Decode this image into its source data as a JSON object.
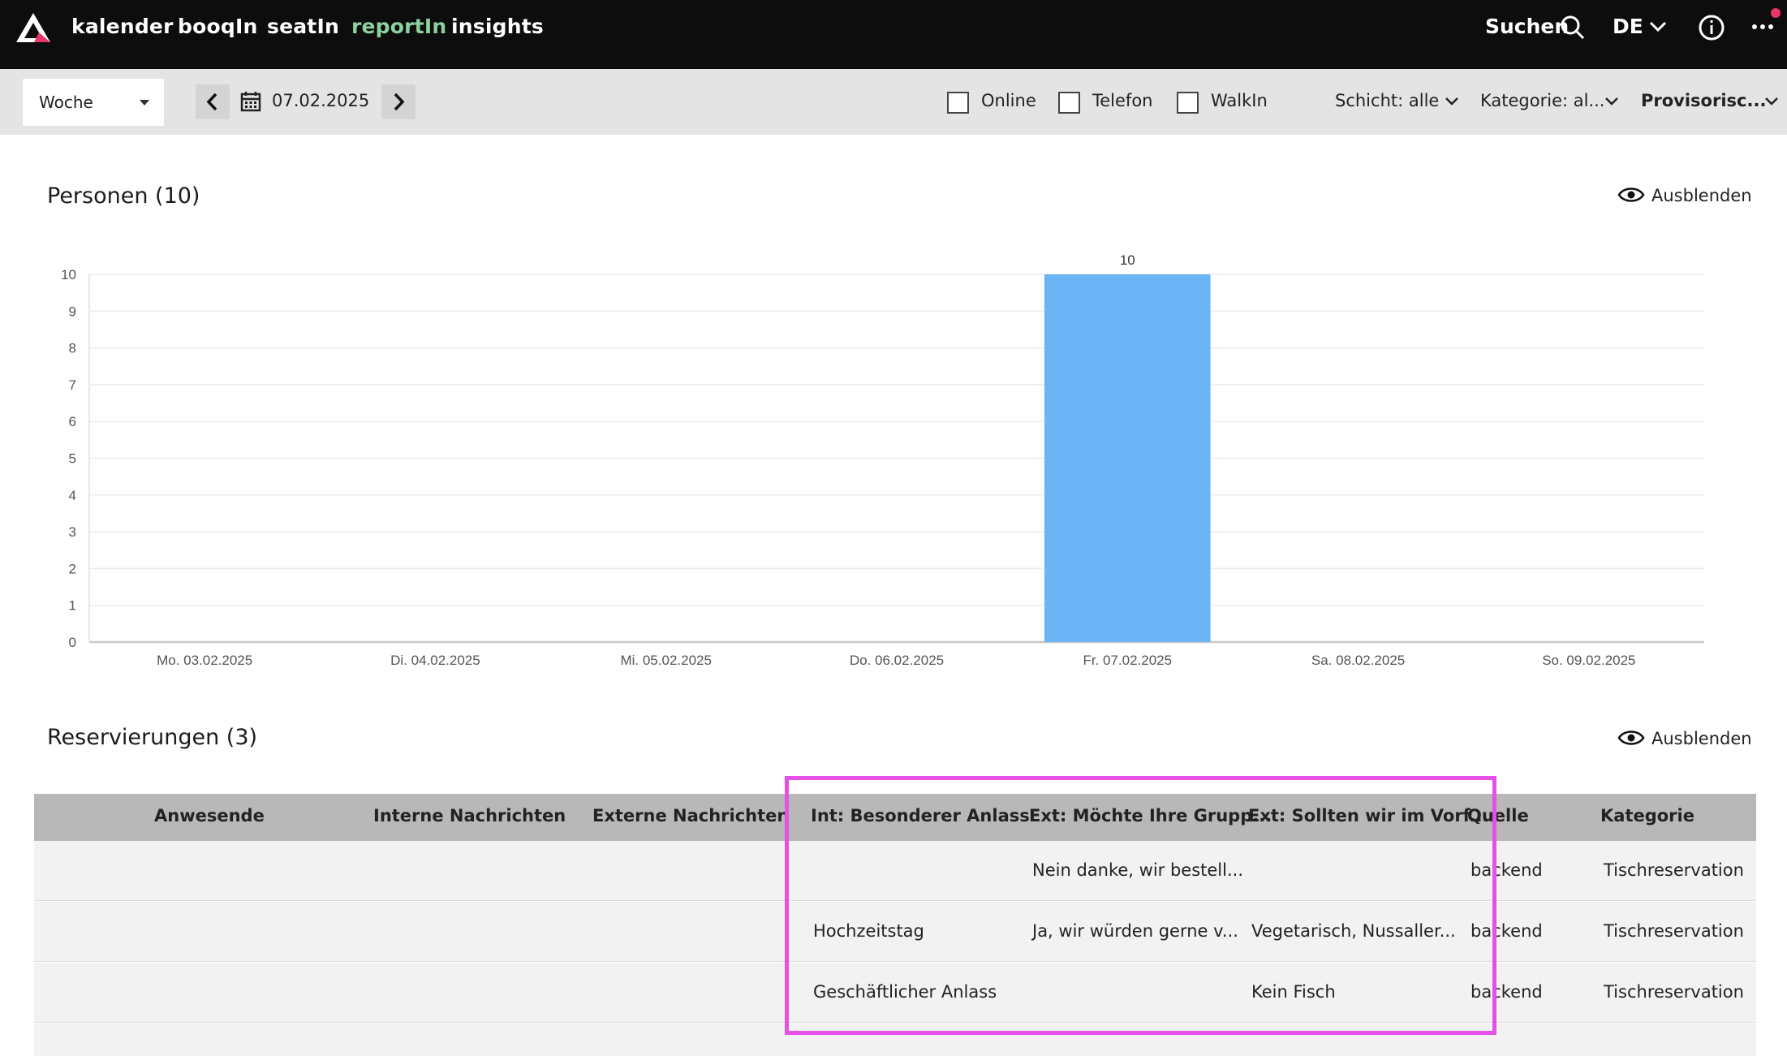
{
  "nav": {
    "items": [
      "kalender",
      "booqIn",
      "seatIn",
      "reportIn",
      "insights"
    ],
    "active": "reportIn",
    "search_label": "Suchen",
    "language": "DE"
  },
  "toolbar": {
    "period": "Woche",
    "date": "07.02.2025",
    "checkboxes": [
      "Online",
      "Telefon",
      "WalkIn"
    ],
    "filters": {
      "shift": "Schicht: alle",
      "category": "Kategorie: al...",
      "status": "Provisorisc..."
    }
  },
  "persons_section": {
    "title": "Personen (10)",
    "hide_label": "Ausblenden"
  },
  "chart_data": {
    "type": "bar",
    "categories": [
      "Mo. 03.02.2025",
      "Di. 04.02.2025",
      "Mi. 05.02.2025",
      "Do. 06.02.2025",
      "Fr. 07.02.2025",
      "Sa. 08.02.2025",
      "So. 09.02.2025"
    ],
    "values": [
      0,
      0,
      0,
      0,
      10,
      0,
      0
    ],
    "data_labels": [
      "",
      "",
      "",
      "",
      "10",
      "",
      ""
    ],
    "ylim": [
      0,
      10
    ],
    "yticks": [
      "0",
      "1",
      "2",
      "3",
      "4",
      "5",
      "6",
      "7",
      "8",
      "9",
      "10"
    ],
    "bar_color": "#6bb5f7",
    "grid": true
  },
  "reservations_section": {
    "title": "Reservierungen (3)",
    "hide_label": "Ausblenden",
    "columns": [
      "Anwesende",
      "Interne Nachrichten",
      "Externe Nachrichten",
      "Int: Besonderer Anlass",
      "Ext: Möchte Ihre Grupp...",
      "Ext: Sollten wir im Vorf...",
      "Quelle",
      "Kategorie"
    ],
    "rows": [
      [
        "",
        "",
        "",
        "",
        "Nein danke, wir bestell...",
        "",
        "backend",
        "Tischreservation"
      ],
      [
        "",
        "",
        "",
        "Hochzeitstag",
        "Ja, wir würden gerne v...",
        "Vegetarisch, Nussaller...",
        "backend",
        "Tischreservation"
      ],
      [
        "",
        "",
        "",
        "Geschäftlicher Anlass",
        "",
        "Kein Fisch",
        "backend",
        "Tischreservation"
      ]
    ]
  },
  "colors": {
    "topbar": "#0d0d0d",
    "active_nav": "#8fd19e",
    "highlight": "#e550e8",
    "notification_dot": "#e8356a"
  }
}
